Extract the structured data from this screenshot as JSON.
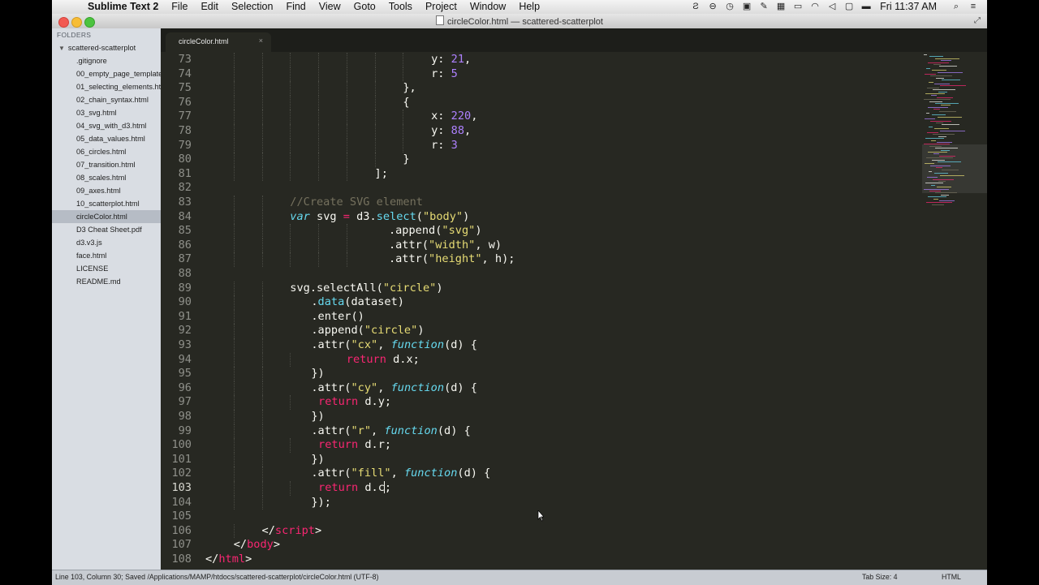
{
  "menubar": {
    "app_name": "Sublime Text 2",
    "items": [
      "File",
      "Edit",
      "Selection",
      "Find",
      "View",
      "Goto",
      "Tools",
      "Project",
      "Window",
      "Help"
    ],
    "clock": "Fri 11:37 AM"
  },
  "window": {
    "title": "circleColor.html — scattered-scatterplot"
  },
  "sidebar": {
    "header": "FOLDERS",
    "folder_name": "scattered-scatterplot",
    "files": [
      ".gitignore",
      "00_empty_page_template.html",
      "01_selecting_elements.html",
      "02_chain_syntax.html",
      "03_svg.html",
      "04_svg_with_d3.html",
      "05_data_values.html",
      "06_circles.html",
      "07_transition.html",
      "08_scales.html",
      "09_axes.html",
      "10_scatterplot.html",
      "circleColor.html",
      "D3 Cheat Sheet.pdf",
      "d3.v3.js",
      "face.html",
      "LICENSE",
      "README.md"
    ],
    "selected_index": 12
  },
  "tab": {
    "label": "circleColor.html",
    "close": "×"
  },
  "editor": {
    "current_line": 103,
    "lines": [
      {
        "n": "73",
        "i": 8,
        "t": [
          [
            "",
            "y: "
          ],
          [
            "num",
            "21"
          ],
          [
            "",
            ","
          ]
        ]
      },
      {
        "n": "74",
        "i": 8,
        "t": [
          [
            "",
            "r: "
          ],
          [
            "num",
            "5"
          ]
        ]
      },
      {
        "n": "75",
        "i": 7,
        "t": [
          [
            "",
            "},"
          ]
        ]
      },
      {
        "n": "76",
        "i": 7,
        "t": [
          [
            "",
            "{"
          ]
        ]
      },
      {
        "n": "77",
        "i": 8,
        "t": [
          [
            "",
            "x: "
          ],
          [
            "num",
            "220"
          ],
          [
            "",
            ","
          ]
        ]
      },
      {
        "n": "78",
        "i": 8,
        "t": [
          [
            "",
            "y: "
          ],
          [
            "num",
            "88"
          ],
          [
            "",
            ","
          ]
        ]
      },
      {
        "n": "79",
        "i": 8,
        "t": [
          [
            "",
            "r: "
          ],
          [
            "num",
            "3"
          ]
        ]
      },
      {
        "n": "80",
        "i": 7,
        "t": [
          [
            "",
            "}"
          ]
        ]
      },
      {
        "n": "81",
        "i": 6,
        "t": [
          [
            "",
            "];"
          ]
        ]
      },
      {
        "n": "82",
        "i": 0,
        "t": []
      },
      {
        "n": "83",
        "i": 3,
        "t": [
          [
            "cm",
            "//Create SVG element"
          ]
        ]
      },
      {
        "n": "84",
        "i": 3,
        "t": [
          [
            "kw",
            "var"
          ],
          [
            "",
            " svg "
          ],
          [
            "op",
            "="
          ],
          [
            "",
            " d3."
          ],
          [
            "fn",
            "select"
          ],
          [
            "",
            "("
          ],
          [
            "str",
            "\"body\""
          ],
          [
            "",
            ")"
          ]
        ]
      },
      {
        "n": "85",
        "i": 6,
        "s": 2,
        "t": [
          [
            "",
            "."
          ],
          [
            "",
            "append("
          ],
          [
            "str",
            "\"svg\""
          ],
          [
            "",
            ")"
          ]
        ]
      },
      {
        "n": "86",
        "i": 6,
        "s": 2,
        "t": [
          [
            "",
            ".attr("
          ],
          [
            "str",
            "\"width\""
          ],
          [
            "",
            ", w)"
          ]
        ]
      },
      {
        "n": "87",
        "i": 6,
        "s": 2,
        "t": [
          [
            "",
            ".attr("
          ],
          [
            "str",
            "\"height\""
          ],
          [
            "",
            ", h);"
          ]
        ]
      },
      {
        "n": "88",
        "i": 0,
        "t": []
      },
      {
        "n": "89",
        "i": 3,
        "t": [
          [
            "",
            "svg.selectAll("
          ],
          [
            "str",
            "\"circle\""
          ],
          [
            "",
            ")"
          ]
        ]
      },
      {
        "n": "90",
        "i": 3,
        "s": 3,
        "t": [
          [
            "",
            "."
          ],
          [
            "fn",
            "data"
          ],
          [
            "",
            "(dataset)"
          ]
        ]
      },
      {
        "n": "91",
        "i": 3,
        "s": 3,
        "t": [
          [
            "",
            ".enter()"
          ]
        ]
      },
      {
        "n": "92",
        "i": 3,
        "s": 3,
        "t": [
          [
            "",
            ".append("
          ],
          [
            "str",
            "\"circle\""
          ],
          [
            "",
            ")"
          ]
        ]
      },
      {
        "n": "93",
        "i": 3,
        "s": 3,
        "t": [
          [
            "",
            ".attr("
          ],
          [
            "str",
            "\"cx\""
          ],
          [
            "",
            ", "
          ],
          [
            "kw",
            "function"
          ],
          [
            "",
            "(d) {"
          ]
        ]
      },
      {
        "n": "94",
        "i": 4,
        "s": 4,
        "t": [
          [
            "ret",
            "return"
          ],
          [
            "",
            " d.x;"
          ]
        ]
      },
      {
        "n": "95",
        "i": 3,
        "s": 3,
        "t": [
          [
            "",
            "})"
          ]
        ]
      },
      {
        "n": "96",
        "i": 3,
        "s": 3,
        "t": [
          [
            "",
            ".attr("
          ],
          [
            "str",
            "\"cy\""
          ],
          [
            "",
            ", "
          ],
          [
            "kw",
            "function"
          ],
          [
            "",
            "(d) {"
          ]
        ]
      },
      {
        "n": "97",
        "i": 4,
        "s": 0,
        "t": [
          [
            "ret",
            "return"
          ],
          [
            "",
            " d.y;"
          ]
        ]
      },
      {
        "n": "98",
        "i": 3,
        "s": 3,
        "t": [
          [
            "",
            "})"
          ]
        ]
      },
      {
        "n": "99",
        "i": 3,
        "s": 3,
        "t": [
          [
            "",
            ".attr("
          ],
          [
            "str",
            "\"r\""
          ],
          [
            "",
            ", "
          ],
          [
            "kw",
            "function"
          ],
          [
            "",
            "(d) {"
          ]
        ]
      },
      {
        "n": "100",
        "i": 4,
        "s": 0,
        "t": [
          [
            "ret",
            "return"
          ],
          [
            "",
            " d.r;"
          ]
        ]
      },
      {
        "n": "101",
        "i": 3,
        "s": 3,
        "t": [
          [
            "",
            "})"
          ]
        ]
      },
      {
        "n": "102",
        "i": 3,
        "s": 3,
        "t": [
          [
            "",
            ".attr("
          ],
          [
            "str",
            "\"fill\""
          ],
          [
            "",
            ", "
          ],
          [
            "kw",
            "function"
          ],
          [
            "",
            "(d) {"
          ]
        ]
      },
      {
        "n": "103",
        "i": 4,
        "s": 0,
        "t": [
          [
            "ret",
            "return"
          ],
          [
            "",
            " d.c"
          ],
          [
            "caret",
            ""
          ],
          [
            "",
            ";"
          ]
        ]
      },
      {
        "n": "104",
        "i": 3,
        "s": 3,
        "t": [
          [
            "",
            "});"
          ]
        ]
      },
      {
        "n": "105",
        "i": 0,
        "t": []
      },
      {
        "n": "106",
        "i": 2,
        "t": [
          [
            "",
            "</"
          ],
          [
            "tag",
            "script"
          ],
          [
            "",
            ">"
          ]
        ]
      },
      {
        "n": "107",
        "i": 1,
        "t": [
          [
            "",
            "</"
          ],
          [
            "tag",
            "body"
          ],
          [
            "",
            ">"
          ]
        ]
      },
      {
        "n": "108",
        "i": 0,
        "t": [
          [
            "",
            "</"
          ],
          [
            "tag",
            "html"
          ],
          [
            "",
            ">"
          ]
        ]
      }
    ]
  },
  "status": {
    "left": "Line 103, Column 30; Saved /Applications/MAMP/htdocs/scattered-scatterplot/circleColor.html (UTF-8)",
    "tab_size": "Tab Size: 4",
    "syntax": "HTML"
  },
  "colors": {
    "editor_bg": "#272822",
    "comment": "#75715e",
    "keyword": "#66d9ef",
    "string": "#e6db74",
    "number": "#ae81ff",
    "tag": "#f92672"
  }
}
